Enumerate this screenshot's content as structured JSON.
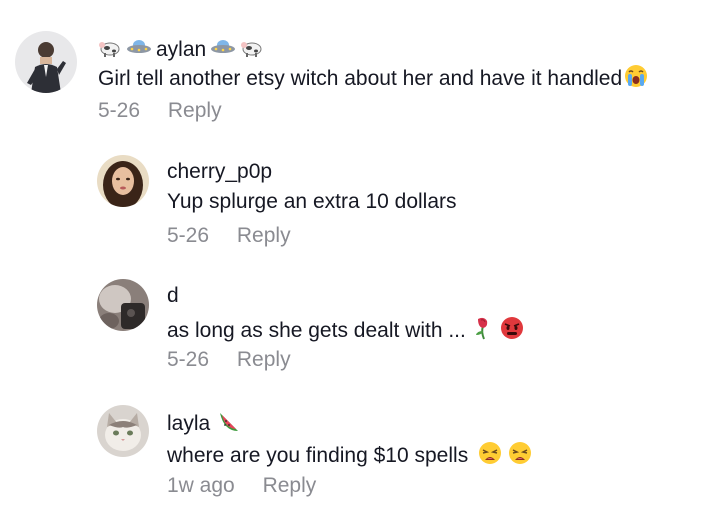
{
  "comments": [
    {
      "username": "aylan",
      "username_prefix_icons": [
        "cow-icon",
        "ufo-icon"
      ],
      "username_suffix_icons": [
        "ufo-icon",
        "cow-icon"
      ],
      "text": "Girl tell another etsy witch about her and have it handled",
      "text_emojis": [
        "crying-face-icon"
      ],
      "date": "5-26",
      "reply_label": "Reply"
    },
    {
      "username": "cherry_p0p",
      "text": "Yup splurge an extra 10 dollars",
      "date": "5-26",
      "reply_label": "Reply"
    },
    {
      "username": "d",
      "text": "as long as she gets dealt with ...",
      "text_emojis": [
        "wilted-rose-icon",
        "angry-face-icon"
      ],
      "date": "5-26",
      "reply_label": "Reply"
    },
    {
      "username": "layla",
      "username_suffix_icons": [
        "watermelon-icon"
      ],
      "text": "where are you finding $10 spells",
      "text_emojis": [
        "weary-face-icon",
        "weary-face-icon"
      ],
      "date": "1w ago",
      "reply_label": "Reply"
    }
  ],
  "colors": {
    "primary_text": "#161823",
    "secondary_text": "#8a8b91",
    "background": "#ffffff"
  }
}
